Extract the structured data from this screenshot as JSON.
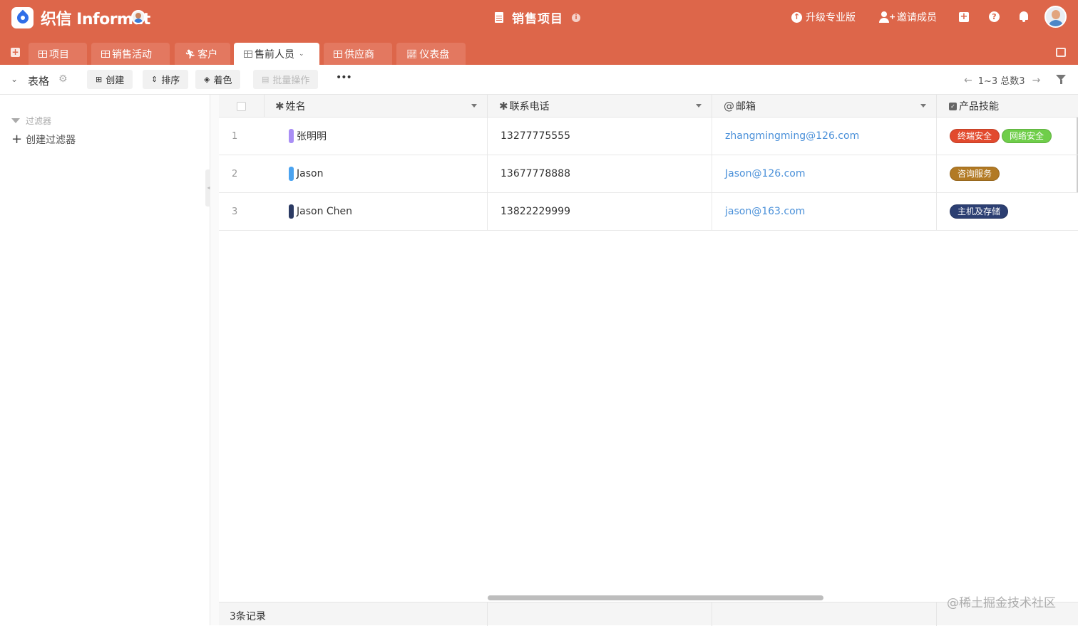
{
  "header": {
    "brand": "织信 Informat",
    "doc_title": "销售项目",
    "upgrade_label": "升级专业版",
    "invite_label": "邀请成员"
  },
  "tabs": [
    {
      "label": "项目",
      "icon": "grid-icon",
      "active": false
    },
    {
      "label": "销售活动",
      "icon": "grid-icon",
      "active": false
    },
    {
      "label": "客户",
      "icon": "person-icon",
      "active": false
    },
    {
      "label": "售前人员",
      "icon": "grid-icon",
      "active": true
    },
    {
      "label": "供应商",
      "icon": "grid-icon",
      "active": false
    },
    {
      "label": "仪表盘",
      "icon": "chart-icon",
      "active": false
    }
  ],
  "toolbar": {
    "view_name": "表格",
    "create_label": "创建",
    "sort_label": "排序",
    "color_label": "着色",
    "batch_label": "批量操作",
    "more_label": "•••",
    "pager_text": "1~3 总数3"
  },
  "sidebar": {
    "filter_title": "过滤器",
    "create_filter": "创建过滤器"
  },
  "table": {
    "columns": [
      {
        "label": "姓名",
        "prefix": "✱"
      },
      {
        "label": "联系电话",
        "prefix": "✱"
      },
      {
        "label": "邮箱",
        "prefix": "@"
      },
      {
        "label": "产品技能",
        "prefix": "☑"
      }
    ],
    "rows": [
      {
        "num": "1",
        "name": "张明明",
        "bar_color": "#a98ef5",
        "phone": "13277775555",
        "email": "zhangmingming@126.com",
        "skills": [
          {
            "label": "终端安全",
            "color": "#e24a2e"
          },
          {
            "label": "网络安全",
            "color": "#6fce4a"
          }
        ]
      },
      {
        "num": "2",
        "name": "Jason",
        "bar_color": "#4aa3f0",
        "phone": "13677778888",
        "email": "Jason@126.com",
        "skills": [
          {
            "label": "咨询服务",
            "color": "#b27a24"
          }
        ]
      },
      {
        "num": "3",
        "name": "Jason Chen",
        "bar_color": "#2b3a63",
        "phone": "13822229999",
        "email": "jason@163.com",
        "skills": [
          {
            "label": "主机及存储",
            "color": "#2c3f72"
          }
        ]
      }
    ],
    "footer_count": "3条记录"
  },
  "watermark": "@稀土掘金技术社区",
  "colors": {
    "brand_header": "#dd664a",
    "tab_inactive": "#e37860",
    "link": "#4a90d9"
  }
}
